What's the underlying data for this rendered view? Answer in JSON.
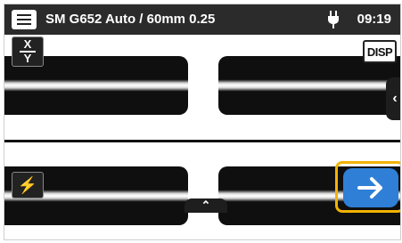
{
  "header": {
    "title": "SM G652 Auto / 60mm 0.25",
    "time": "09:19"
  },
  "controls": {
    "xy": {
      "x_label": "X",
      "y_label": "Y"
    },
    "disp_label": "DISP",
    "side_tab_glyph": "‹",
    "up_tab_glyph": "⌃",
    "arc_glyph": "⚡",
    "next_glyph": "→"
  },
  "colors": {
    "topbar": "#2b2b2b",
    "accent_highlight": "#f2b300",
    "next_button": "#2f7fd6"
  },
  "icons": [
    "menu-icon",
    "power-plug-icon",
    "xy-switch-icon",
    "display-icon",
    "chevron-left-icon",
    "chevron-up-icon",
    "arc-icon",
    "arrow-right-icon"
  ]
}
